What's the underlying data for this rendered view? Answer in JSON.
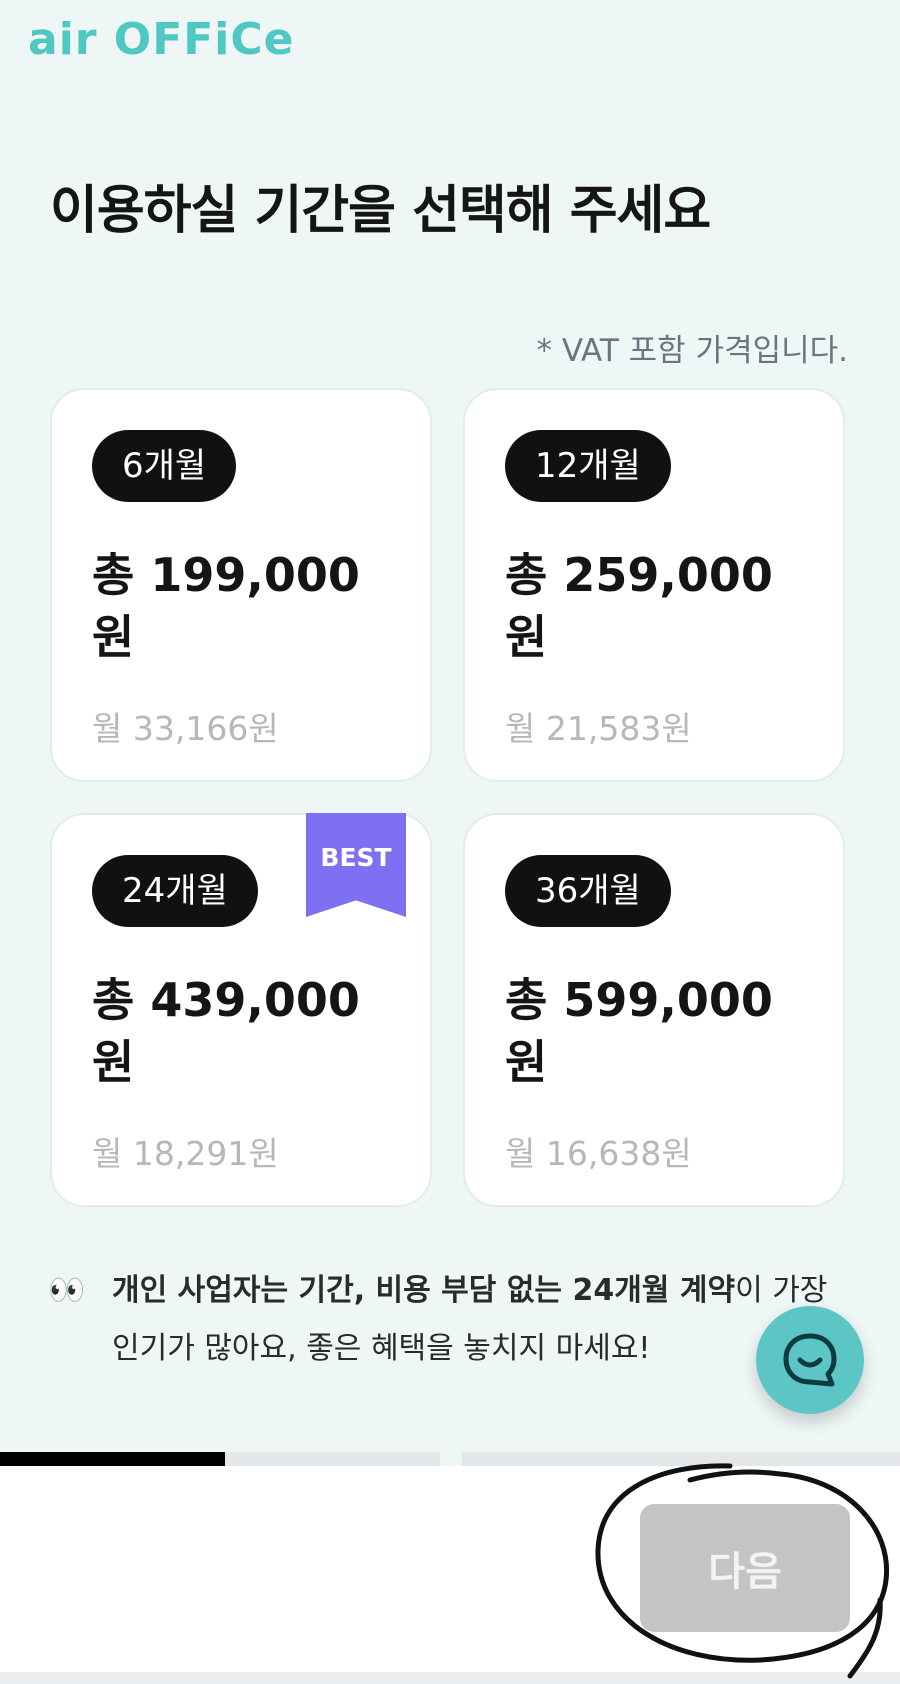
{
  "logo": "air OFFiCe",
  "title": "이용하실 기간을 선택해 주세요",
  "vat_note": "* VAT 포함 가격입니다.",
  "plans": [
    {
      "period": "6개월",
      "total": "총 199,000원",
      "monthly": "월 33,166원"
    },
    {
      "period": "12개월",
      "total": "총 259,000원",
      "monthly": "월 21,583원"
    },
    {
      "period": "24개월",
      "total": "총 439,000원",
      "monthly": "월 18,291원",
      "badge": "BEST"
    },
    {
      "period": "36개월",
      "total": "총 599,000원",
      "monthly": "월 16,638원"
    }
  ],
  "tip": {
    "emoji": "👀",
    "bold_part": "개인 사업자는 기간, 비용 부담 없는 24개월 계약",
    "rest": "이 가장 인기가 많아요, 좋은 혜택을 놓치지 마세요!"
  },
  "chat_icon": "chat-bubble-smile-icon",
  "progress": {
    "current_step": 1,
    "total_steps": 4
  },
  "next_button": "다음",
  "colors": {
    "brand": "#4fc7c2",
    "best_badge": "#7e6ff3",
    "chat": "#5cc6c6",
    "disabled_button": "#c4c4c4"
  }
}
